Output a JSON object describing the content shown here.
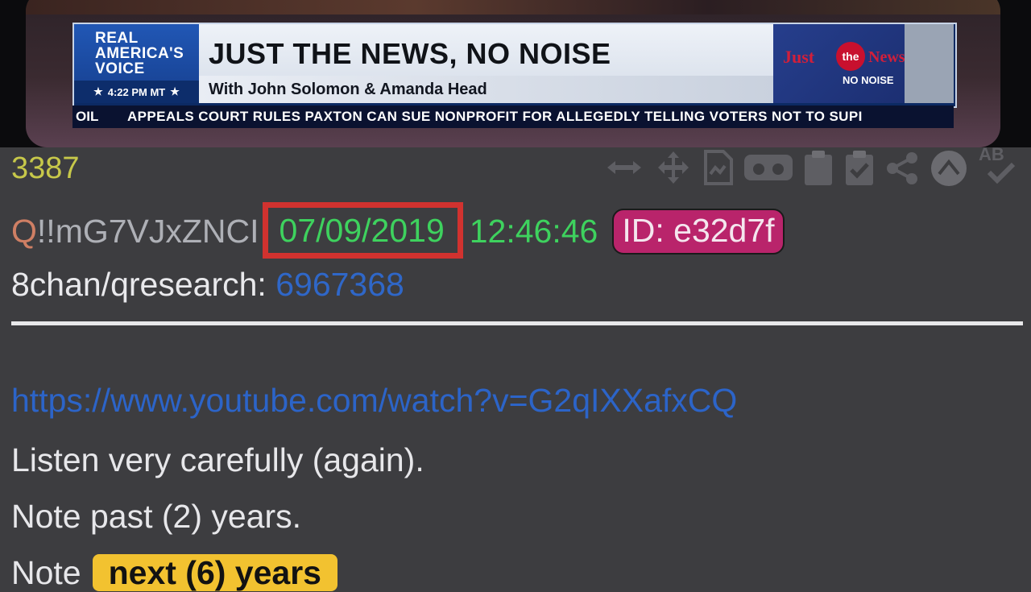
{
  "video": {
    "network_logo": "REAL\nAMERICA'S\nVOICE",
    "time_label": "4:22 PM MT",
    "show_title": "JUST THE NEWS, NO NOISE",
    "show_subtitle": "With John Solomon & Amanda Head",
    "brand_logo": "Just the News. NO NOISE",
    "ticker_fragment": "OIL",
    "ticker_text": "APPEALS COURT RULES PAXTON CAN SUE NONPROFIT FOR ALLEGEDLY TELLING VOTERS NOT TO SUPI"
  },
  "toolbar": {
    "icons": [
      "resize-horizontal-icon",
      "move-icon",
      "document-icon",
      "vr-headset-icon",
      "clipboard-icon",
      "clipboard-check-icon",
      "share-icon",
      "up-arrow-circle-icon",
      "translate-icon"
    ],
    "translate_label": "AB"
  },
  "post": {
    "number": "3387",
    "author_q": "Q",
    "tripcode": "!!mG7VJxZNCI",
    "date": "07/09/2019",
    "time": "12:46:46",
    "id_label": "ID: e32d7f",
    "board": "8chan/qresearch:",
    "board_post": "6967368",
    "link": "https://www.youtube.com/watch?v=G2qIXXafxCQ",
    "line1": "Listen very carefully (again).",
    "line2": "Note past (2) years.",
    "line3_prefix": "Note",
    "line3_highlight": "next (6) years"
  },
  "colors": {
    "background": "#3d3d40",
    "date_green": "#3ed25e",
    "date_box_red": "#d1322f",
    "id_badge": "#b9246b",
    "link_blue": "#2c64c8",
    "highlight_yellow": "#f2c230",
    "post_number": "#c7c84a"
  }
}
